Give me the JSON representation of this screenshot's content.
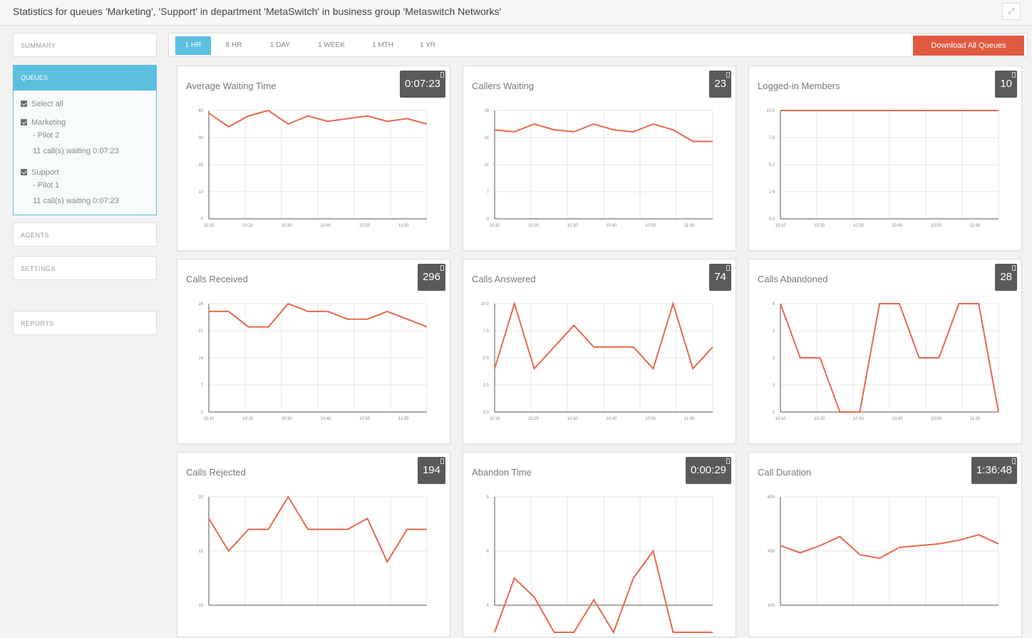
{
  "header": {
    "subtitle": "Statistics for queues 'Marketing', 'Support' in department 'MetaSwitch' in business group 'Metaswitch Networks'",
    "expand_icon": "expand-icon"
  },
  "sidebar": {
    "summary_label": "SUMMARY",
    "queues_label": "QUEUES",
    "select_all": "Select all",
    "queues": [
      {
        "name": "Marketing",
        "pilot": "- Pilot 2",
        "waiting": "11 call(s) waiting 0:07:23"
      },
      {
        "name": "Support",
        "pilot": "- Pilot 1",
        "waiting": "11 call(s) waiting 0:07:23"
      }
    ],
    "agents_label": "AGENTS",
    "settings_label": "SETTINGS",
    "reports_label": "REPORTS"
  },
  "toolbar": {
    "ranges": [
      "1 HR",
      "8 HR",
      "1 DAY",
      "1 WEEK",
      "1 MTH",
      "1 YR"
    ],
    "active_range": "1 HR",
    "download_label": "Download All Queues"
  },
  "colors": {
    "accent": "#5bc0de",
    "line": "#e8684a",
    "download": "#e05a41",
    "value_box": "#5a5a5a"
  },
  "cards": [
    {
      "title": "Average Waiting Time",
      "value": "0:07:23",
      "yticks": [
        "0",
        "10",
        "20",
        "30",
        "40"
      ],
      "ymax": 40,
      "xticks": [
        "10:10",
        "10:20",
        "10:30",
        "10:40",
        "10:50",
        "11:00"
      ],
      "series": [
        39,
        34,
        38,
        40,
        35,
        38,
        36,
        37,
        38,
        36,
        37,
        35
      ]
    },
    {
      "title": "Callers Waiting",
      "value": "23",
      "yticks": [
        "0",
        "7",
        "14",
        "21",
        "28"
      ],
      "ymax": 28,
      "xticks": [
        "10:10",
        "10:20",
        "10:30",
        "10:40",
        "10:50",
        "11:00"
      ],
      "series": [
        23,
        22.5,
        24.5,
        23,
        22.5,
        24.5,
        23,
        22.5,
        24.5,
        23,
        20,
        20
      ]
    },
    {
      "title": "Logged-in Members",
      "value": "10",
      "yticks": [
        "0.0",
        "2.6",
        "5.2",
        "7.8",
        "10.5"
      ],
      "ymax": 10.5,
      "xticks": [
        "10:10",
        "10:20",
        "10:30",
        "10:40",
        "10:50",
        "11:00"
      ],
      "series": [
        10.5,
        10.5,
        10.5,
        10.5,
        10.5,
        10.5,
        10.5,
        10.5,
        10.5,
        10.5,
        10.5,
        10.5
      ]
    },
    {
      "title": "Calls Received",
      "value": "296",
      "yticks": [
        "0",
        "7",
        "14",
        "21",
        "28"
      ],
      "ymax": 28,
      "xticks": [
        "10:10",
        "10:20",
        "10:30",
        "10:40",
        "10:50",
        "11:00"
      ],
      "series": [
        26,
        26,
        22,
        22,
        28,
        26,
        26,
        24,
        24,
        26,
        24,
        22
      ]
    },
    {
      "title": "Calls Answered",
      "value": "74",
      "yticks": [
        "0.0",
        "2.5",
        "5.0",
        "7.5",
        "10.0"
      ],
      "ymax": 10,
      "xticks": [
        "10:10",
        "10:20",
        "10:30",
        "10:40",
        "10:50",
        "11:00"
      ],
      "series": [
        4,
        10,
        4,
        6,
        8,
        6,
        6,
        6,
        4,
        10,
        4,
        6
      ]
    },
    {
      "title": "Calls Abandoned",
      "value": "28",
      "yticks": [
        "0",
        "1",
        "2",
        "3",
        "4"
      ],
      "ymax": 4,
      "xticks": [
        "10:10",
        "10:20",
        "10:30",
        "10:40",
        "10:50",
        "11:00"
      ],
      "series": [
        4,
        2,
        2,
        0,
        0,
        4,
        4,
        2,
        2,
        4,
        4,
        0
      ]
    },
    {
      "title": "Calls Rejected",
      "value": "194",
      "yticks": [
        "10",
        "15",
        "20"
      ],
      "ymax": 20,
      "xticks": [],
      "series": [
        18,
        15,
        17,
        17,
        20,
        17,
        17,
        17,
        18,
        14,
        17,
        17
      ]
    },
    {
      "title": "Abandon Time",
      "value": "0:00:29",
      "yticks": [
        "4",
        "6",
        "8"
      ],
      "ymax": 8,
      "xticks": [],
      "series": [
        3,
        5,
        4.3,
        3,
        3,
        4.2,
        3,
        5,
        6,
        3,
        3,
        3
      ]
    },
    {
      "title": "Call Duration",
      "value": "1:36:48",
      "yticks": [
        "300",
        "450",
        "600"
      ],
      "ymax": 600,
      "xticks": [],
      "series": [
        465,
        445,
        465,
        490,
        440,
        430,
        460,
        465,
        470,
        480,
        495,
        470
      ]
    }
  ]
}
